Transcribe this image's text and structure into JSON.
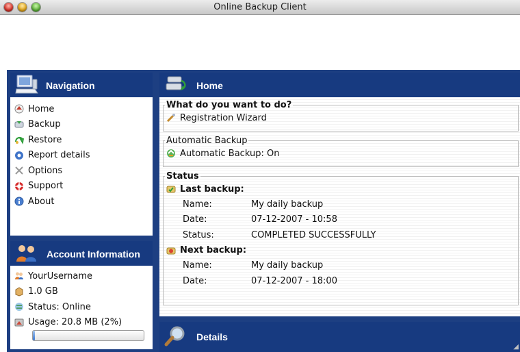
{
  "window": {
    "title": "Online Backup Client"
  },
  "navigation": {
    "title": "Navigation",
    "items": [
      {
        "label": "Home",
        "icon": "home-icon"
      },
      {
        "label": "Backup",
        "icon": "backup-icon"
      },
      {
        "label": "Restore",
        "icon": "restore-icon"
      },
      {
        "label": "Report details",
        "icon": "report-icon"
      },
      {
        "label": "Options",
        "icon": "options-icon"
      },
      {
        "label": "Support",
        "icon": "support-icon"
      },
      {
        "label": "About",
        "icon": "about-icon"
      }
    ]
  },
  "account": {
    "title": "Account Information",
    "username": "YourUsername",
    "quota": "1.0 GB",
    "status": "Status: Online",
    "usage": "Usage: 20.8 MB (2%)",
    "usage_fraction": 0.02
  },
  "home": {
    "title": "Home",
    "what_to_do": {
      "legend": "What do you want to do?",
      "action": "Registration Wizard"
    },
    "auto_backup": {
      "legend": "Automatic Backup",
      "status": "Automatic Backup: On"
    },
    "status": {
      "legend": "Status",
      "last": {
        "title": "Last backup:",
        "name_label": "Name:",
        "name": "My daily backup",
        "date_label": "Date:",
        "date": "07-12-2007 - 10:58",
        "status_label": "Status:",
        "status": "COMPLETED SUCCESSFULLY"
      },
      "next": {
        "title": "Next backup:",
        "name_label": "Name:",
        "name": "My daily backup",
        "date_label": "Date:",
        "date": "07-12-2007 - 18:00"
      }
    }
  },
  "details": {
    "title": "Details"
  },
  "colors": {
    "panel_header": "#173a80",
    "frame": "#1d3f82"
  }
}
